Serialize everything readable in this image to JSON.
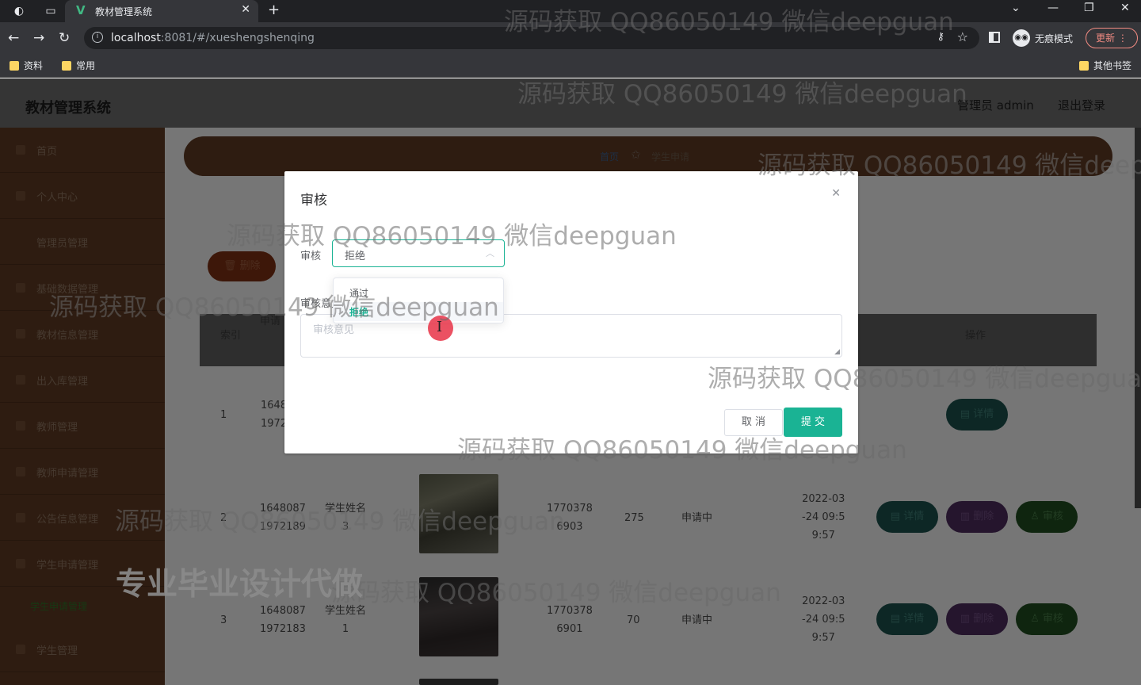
{
  "browser": {
    "tab_title": "教材管理系统",
    "url_host": "localhost",
    "url_rest": ":8081/#/xueshengshenqing",
    "bookmarks": [
      "资料",
      "常用"
    ],
    "other_bookmarks": "其他书签",
    "incognito_label": "无痕模式",
    "update_label": "更新"
  },
  "header": {
    "title": "教材管理系统",
    "admin_label": "管理员 admin",
    "logout_label": "退出登录"
  },
  "sidebar": {
    "items": [
      {
        "label": "首页"
      },
      {
        "label": "个人中心"
      },
      {
        "label": "管理员管理"
      },
      {
        "label": "基础数据管理"
      },
      {
        "label": "教材信息管理"
      },
      {
        "label": "出入库管理"
      },
      {
        "label": "教师管理"
      },
      {
        "label": "教师申请管理"
      },
      {
        "label": "公告信息管理"
      },
      {
        "label": "学生申请管理"
      },
      {
        "label": "学生管理"
      }
    ],
    "sub_item": "学生申请管理"
  },
  "breadcrumb": {
    "home": "首页",
    "current": "学生申请"
  },
  "toolbar": {
    "delete_label": "删除"
  },
  "table": {
    "headers": {
      "index": "索引",
      "apply": "申请",
      "action": "操作"
    },
    "rows": [
      {
        "index": "1",
        "number": "1648\n1972",
        "name": "",
        "phone": "",
        "qty": "",
        "status": "",
        "time": ""
      },
      {
        "index": "2",
        "number": "1648087\n1972189",
        "name": "学生姓名\n3",
        "phone": "1770378\n6903",
        "qty": "275",
        "status": "申请中",
        "time": "2022-03\n-24 09:5\n9:57"
      },
      {
        "index": "3",
        "number": "1648087\n1972183",
        "name": "学生姓名\n1",
        "phone": "1770378\n6901",
        "qty": "70",
        "status": "申请中",
        "time": "2022-03\n-24 09:5\n9:57"
      }
    ],
    "detail_label": "详情",
    "delete_label": "删除",
    "audit_label": "审核"
  },
  "dialog": {
    "title": "审核",
    "audit_label": "审核",
    "audit_value": "拒绝",
    "opinion_label": "审核意见",
    "opinion_placeholder": "审核意见",
    "cancel_label": "取 消",
    "submit_label": "提 交",
    "options": [
      "通过",
      "拒绝"
    ]
  },
  "watermark": {
    "text": "源码获取 QQ86050149 微信deepguan",
    "promo": "专业毕业设计代做"
  },
  "colors": {
    "accent": "#1ab394",
    "sidebar": "#5c3922",
    "header": "#6b6b6b"
  }
}
